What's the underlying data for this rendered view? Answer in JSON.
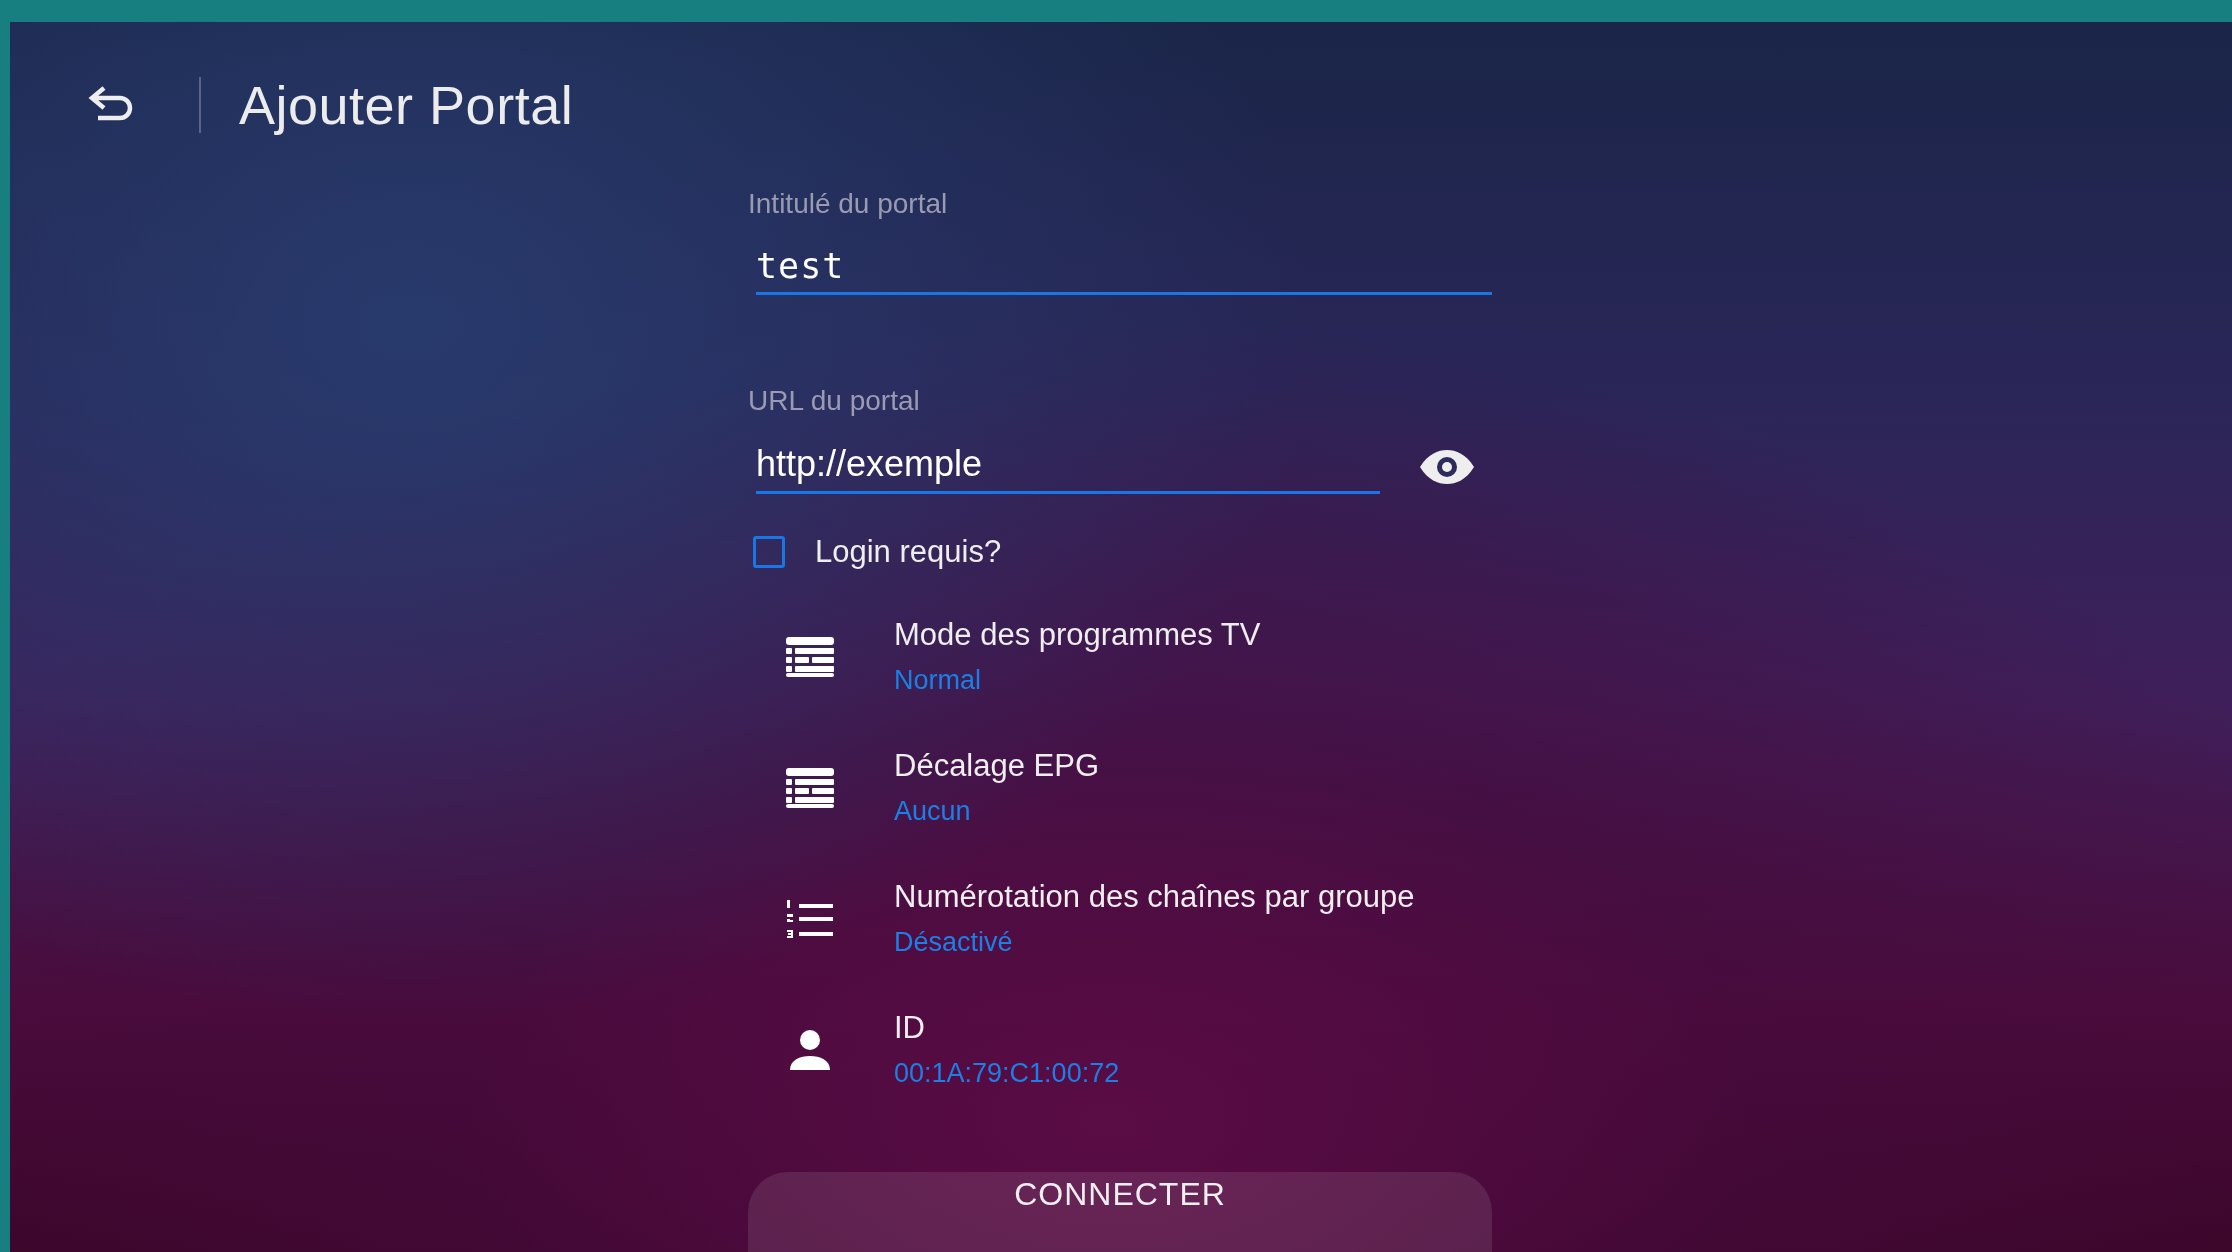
{
  "header": {
    "title": "Ajouter Portal"
  },
  "fields": [
    {
      "label": "Intitulé du portal",
      "value": "test",
      "kind": "mono"
    },
    {
      "label": "URL du portal",
      "value": "http://exemple",
      "kind": "secret"
    }
  ],
  "login_required": {
    "label": "Login requis?",
    "checked": false
  },
  "settings": [
    {
      "title": "Mode des programmes TV",
      "value": "Normal",
      "kind": "grid"
    },
    {
      "title": "Décalage EPG",
      "value": "Aucun",
      "kind": "grid"
    },
    {
      "title": "Numérotation des chaînes par groupe",
      "value": "Désactivé",
      "kind": "numbered"
    },
    {
      "title": "ID",
      "value": "00:1A:79:C1:00:72",
      "kind": "person"
    }
  ],
  "connect_button": {
    "label": "CONNECTER"
  }
}
